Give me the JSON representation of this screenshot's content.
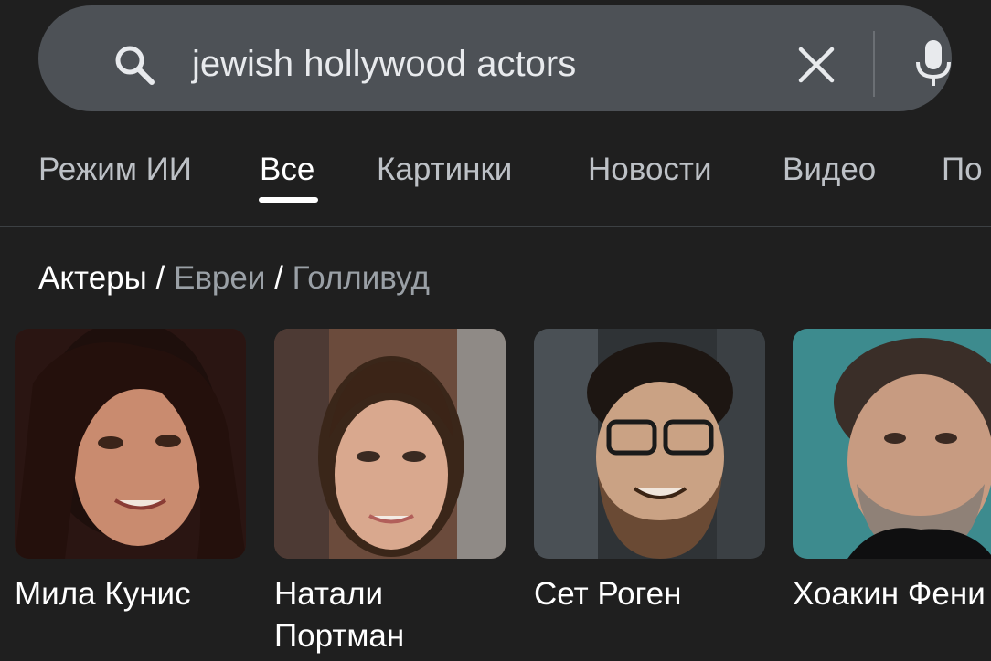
{
  "search": {
    "query": "jewish hollywood actors",
    "icons": [
      "search-icon",
      "clear-icon",
      "mic-icon"
    ]
  },
  "tabs": [
    {
      "label": "Режим ИИ",
      "active": false
    },
    {
      "label": "Все",
      "active": true
    },
    {
      "label": "Картинки",
      "active": false
    },
    {
      "label": "Новости",
      "active": false
    },
    {
      "label": "Видео",
      "active": false
    },
    {
      "label": "По",
      "active": false
    }
  ],
  "breadcrumb": {
    "main": "Актеры",
    "separator": " / ",
    "links": [
      "Евреи",
      "Голливуд"
    ]
  },
  "cards": [
    {
      "name_line1": "Мила Кунис",
      "name_line2": ""
    },
    {
      "name_line1": "Натали",
      "name_line2": "Портман"
    },
    {
      "name_line1": "Сет Роген",
      "name_line2": ""
    },
    {
      "name_line1": "Хоакин Фени",
      "name_line2": ""
    }
  ],
  "colors": {
    "background": "#1f1f1f",
    "search_bar": "#4d5156",
    "tab_inactive": "#bdc1c6",
    "tab_active": "#ffffff",
    "breadcrumb_link": "#9aa0a6"
  }
}
